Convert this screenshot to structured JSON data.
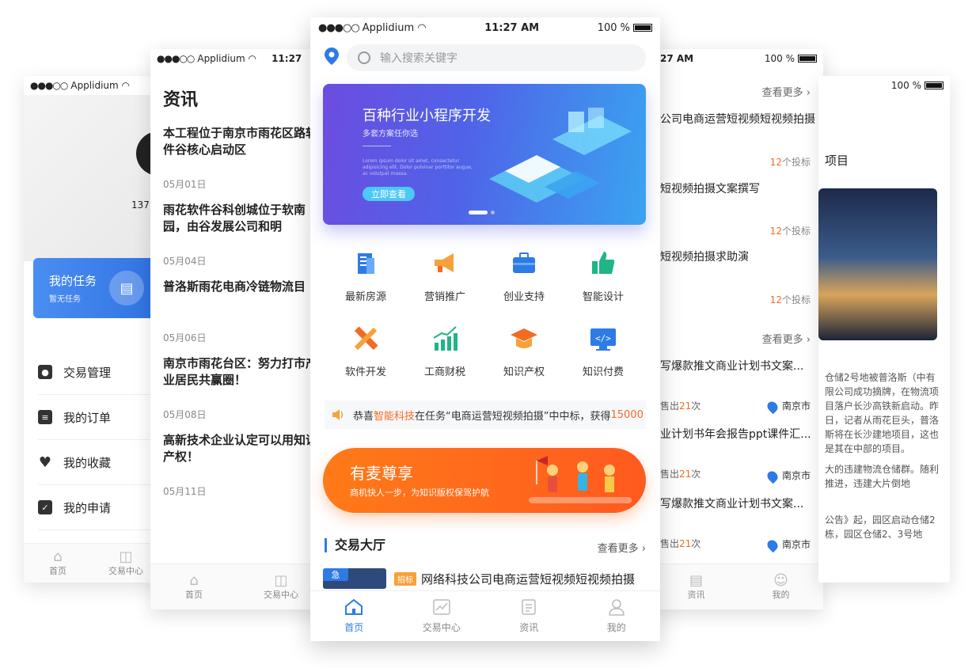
{
  "phone1": {
    "status": {
      "carrier": "Applidium"
    },
    "phone_number": "137",
    "task": {
      "title": "我的任务",
      "subtitle": "暂无任务"
    },
    "menu": [
      "交易管理",
      "我的订单",
      "我的收藏",
      "我的申请"
    ],
    "tabs": [
      "首页",
      "交易中心"
    ]
  },
  "phone2": {
    "status": {
      "carrier": "Applidium",
      "time": "11:27"
    },
    "title": "资讯",
    "news": [
      {
        "title": "本工程位于南京市雨花区路软件谷核心启动区",
        "date": "05月01日"
      },
      {
        "title": "雨花软件谷科创城位于软南园，由谷发展公司和明",
        "date": "05月04日"
      },
      {
        "title": "普洛斯雨花电商冷链物流目",
        "date": "05月06日"
      },
      {
        "title": "南京市雨花台区：努力打市产业居民共赢圈！",
        "date": "05月08日"
      },
      {
        "title": "高新技术企业认定可以用知识产权！",
        "date": "05月11日"
      }
    ],
    "tabs": [
      "首页",
      "交易中心"
    ]
  },
  "phone3": {
    "status": {
      "carrier": "Applidium",
      "time": "11:27 AM",
      "battery": "100 %"
    },
    "search_placeholder": "输入搜索关键字",
    "banner": {
      "title": "百种行业小程序开发",
      "subtitle": "多套方案任你选",
      "small": "Lorem ipsum dolor sit amet, consectetur adipisicing elit. Dolor pulvinar porttitor augue, ac volutpat massa.",
      "button": "立即查看"
    },
    "categories": [
      {
        "label": "最新房源",
        "icon": "building-icon",
        "color": "#2d7be5"
      },
      {
        "label": "营销推广",
        "icon": "megaphone-icon",
        "color": "#f7a13a"
      },
      {
        "label": "创业支持",
        "icon": "briefcase-icon",
        "color": "#2d7be5"
      },
      {
        "label": "智能设计",
        "icon": "thumbs-up-icon",
        "color": "#20b486"
      },
      {
        "label": "软件开发",
        "icon": "pencil-ruler-icon",
        "color": "#f36b21"
      },
      {
        "label": "工商财税",
        "icon": "chart-icon",
        "color": "#20b486"
      },
      {
        "label": "知识产权",
        "icon": "graduation-cap-icon",
        "color": "#f36b21"
      },
      {
        "label": "知识付费",
        "icon": "code-icon",
        "color": "#2d7be5"
      }
    ],
    "notice": {
      "pre": "恭喜",
      "name": "智能科技",
      "mid": "在任务“电商运营短视频拍摄”中中标，获得",
      "amount": "15000"
    },
    "promo": {
      "title": "有麦尊享",
      "subtitle": "商机快人一步，为知识版权保驾护航"
    },
    "section": {
      "title": "交易大厅",
      "more": "查看更多"
    },
    "listing": {
      "urgent": "急",
      "tag": "招标",
      "title": "网络科技公司电商运营短视频短视频拍摄"
    },
    "tabs": [
      "首页",
      "交易中心",
      "资讯",
      "我的"
    ]
  },
  "phone4": {
    "status": {
      "time": "27 AM",
      "battery": "100 %"
    },
    "more": "查看更多",
    "tasks": [
      {
        "title": "公司电商运营短视频短视频拍摄",
        "bids": "12",
        "bid_label": "个投标"
      },
      {
        "title": "短视频拍摄文案撰写",
        "bids": "12",
        "bid_label": "个投标"
      },
      {
        "title": "短视频拍摄求助演",
        "bids": "12",
        "bid_label": "个投标"
      }
    ],
    "services": [
      {
        "title": "写爆款推文商业计划书文案...",
        "sold_pre": "售出",
        "sold": "21",
        "sold_post": "次",
        "city": "南京市"
      },
      {
        "title": "业计划书年会报告ppt课件汇...",
        "sold_pre": "售出",
        "sold": "21",
        "sold_post": "次",
        "city": "南京市"
      },
      {
        "title": "写爆款推文商业计划书文案...",
        "sold_pre": "售出",
        "sold": "21",
        "sold_post": "次",
        "city": "南京市"
      }
    ],
    "tabs": [
      "资讯",
      "我的"
    ]
  },
  "phone5": {
    "status": {
      "battery": "100 %"
    },
    "heading": "项目",
    "paragraphs": [
      "仓储2号地被普洛斯（中有限公司成功摘牌，在物流项目落户长沙高铁新启动。昨日，记者从雨花巨头，普洛斯将在长沙建地项目，这也是其在中部的项目。",
      "大的违建物流仓储群。随利推进，违建大片倒地",
      "公告》起，园区启动仓储2栋，园区仓储2、3号地"
    ]
  }
}
